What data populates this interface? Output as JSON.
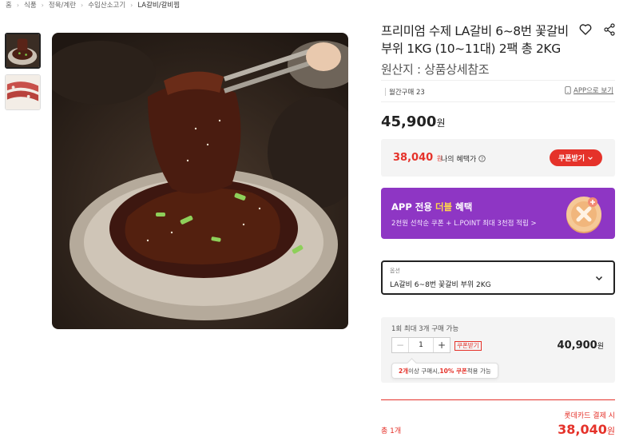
{
  "breadcrumb": [
    "홈",
    "식품",
    "정육/계란",
    "수입산소고기",
    "LA갈비/갈비찜"
  ],
  "product": {
    "title": "프리미엄 수제 LA갈비 6~8번 꽃갈비 부위 1KG (10~11대) 2팩 총 2KG",
    "origin": "원산지 : 상품상세참조",
    "monthly_purchase": "월간구매 23",
    "app_link": "APP으로 보기",
    "price": "45,900",
    "currency": "원"
  },
  "benefit": {
    "price": "38,040",
    "currency": "원",
    "label": "나의 혜택가",
    "coupon_button": "쿠폰받기"
  },
  "app_banner": {
    "title_pre": "APP 전용 ",
    "title_highlight": "더블",
    "title_post": " 혜택",
    "subtitle": "2천원 선착순 쿠폰 + L.POINT 최대 3천점 적립 >"
  },
  "option": {
    "label": "옵션",
    "value": "LA갈비 6~8번 꽃갈비 부위 2KG"
  },
  "quantity": {
    "limit_text": "1회 최대 3개 구매 가능",
    "value": "1",
    "minus": "−",
    "plus": "+",
    "coupon_tag": "쿠폰받기",
    "price": "40,900",
    "currency": "원",
    "tip_count": "2개",
    "tip_mid": " 이상 구매시, ",
    "tip_pct": "10% 쿠폰",
    "tip_end": " 적용 가능"
  },
  "total": {
    "count": "총 1개",
    "card_label": "롯데카드 결제 시",
    "price": "38,040",
    "currency": "원"
  },
  "colors": {
    "accent": "#e5322a",
    "banner": "#8e36c4",
    "highlight": "#ffd84a"
  },
  "icons": [
    "chevron-right-icon",
    "heart-icon",
    "share-icon",
    "phone-icon",
    "info-icon",
    "chevron-down-icon",
    "coin-icon"
  ]
}
